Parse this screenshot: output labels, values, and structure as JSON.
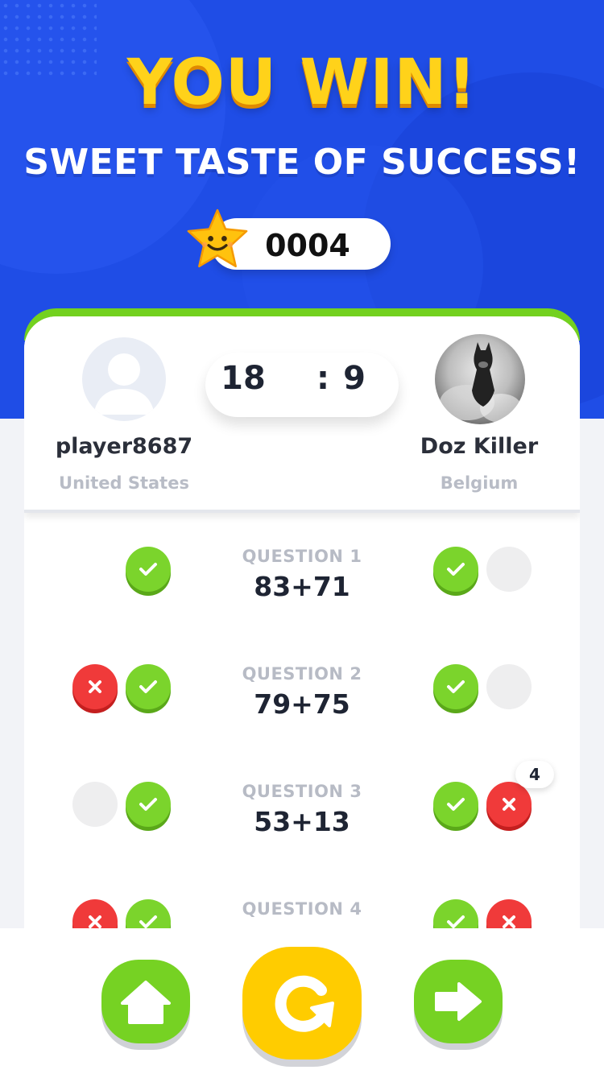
{
  "hero": {
    "title": "YOU WIN!",
    "subtitle": "SWEET TASTE OF SUCCESS!",
    "coins": "0004"
  },
  "match": {
    "player_left": {
      "name": "player8687",
      "country": "United States"
    },
    "player_right": {
      "name": "Doz Killer",
      "country": "Belgium"
    },
    "score_left": "18",
    "score_separator": ":",
    "score_right": "9"
  },
  "questions": [
    {
      "label": "QUESTION 1",
      "expr": "83+71",
      "left": [
        "empty",
        "correct"
      ],
      "right": [
        "correct",
        "empty"
      ]
    },
    {
      "label": "QUESTION 2",
      "expr": "79+75",
      "left": [
        "wrong",
        "correct"
      ],
      "right": [
        "correct",
        "empty"
      ]
    },
    {
      "label": "QUESTION 3",
      "expr": "53+13",
      "left": [
        "empty",
        "correct"
      ],
      "right": [
        "correct",
        "wrong"
      ],
      "right_badge": "4"
    },
    {
      "label": "QUESTION 4",
      "expr": "",
      "left": [
        "wrong",
        "correct"
      ],
      "right": [
        "correct",
        "wrong"
      ]
    }
  ],
  "buttons": {
    "home_icon": "home-icon",
    "replay_icon": "replay-icon",
    "next_icon": "arrow-right-icon"
  },
  "colors": {
    "hero_blue": "#1f4de6",
    "title_yellow": "#ffd21a",
    "correct_green": "#7bd42c",
    "wrong_red": "#f03a3a",
    "replay_yellow": "#ffcc00"
  }
}
